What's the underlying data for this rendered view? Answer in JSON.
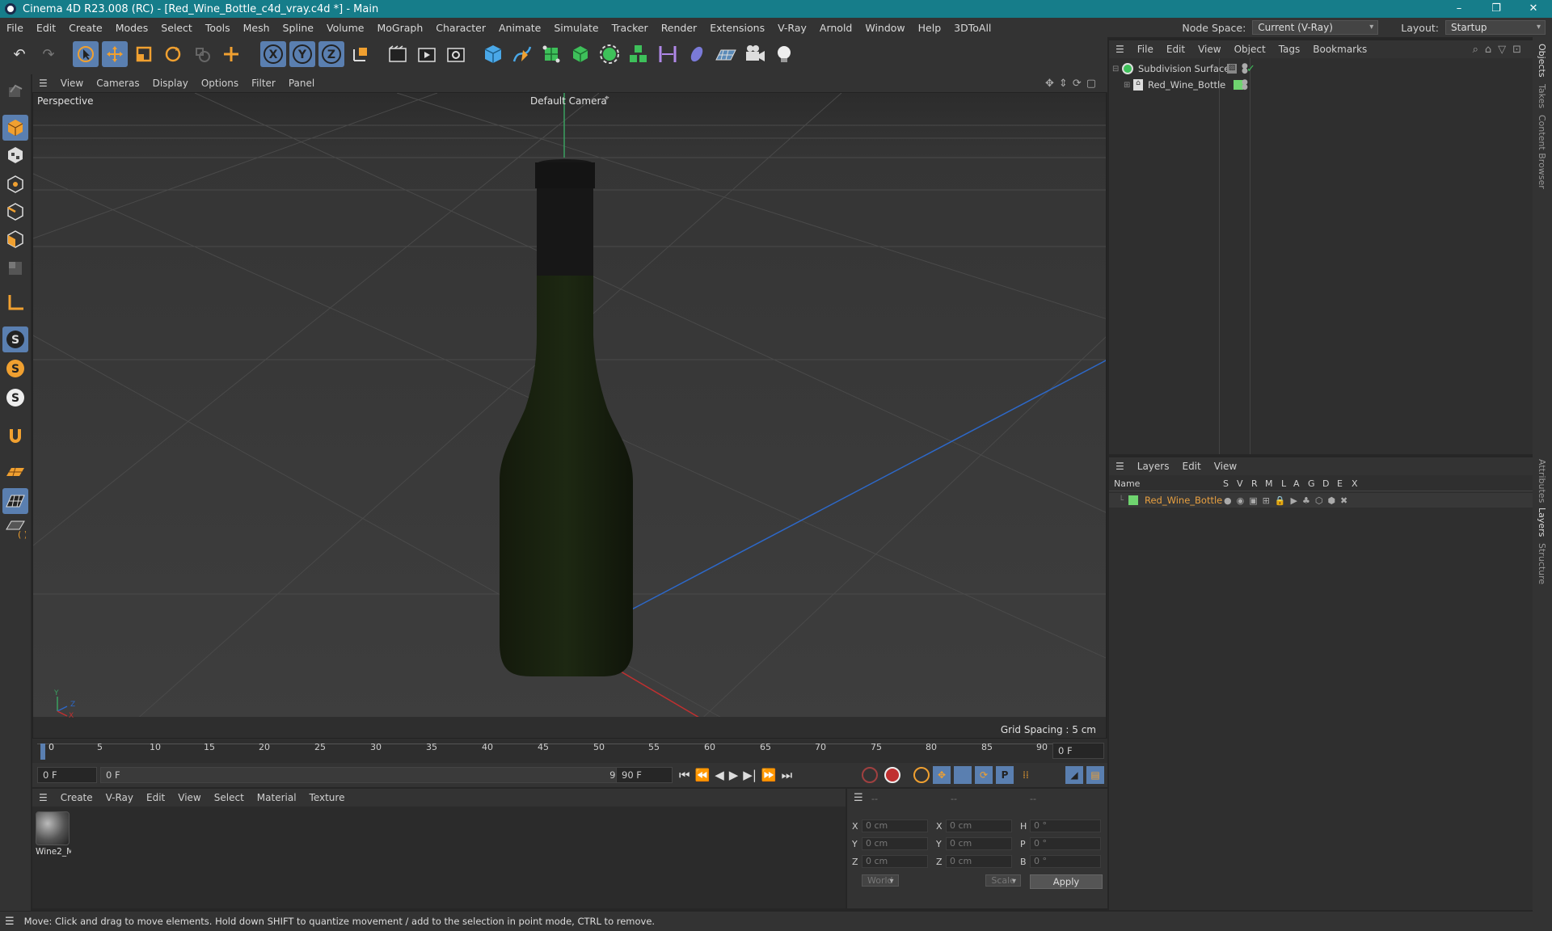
{
  "window": {
    "title": "Cinema 4D R23.008 (RC) - [Red_Wine_Bottle_c4d_vray.c4d *] - Main",
    "minimize": "–",
    "restore": "❐",
    "close": "✕"
  },
  "menubar": {
    "items": [
      "File",
      "Edit",
      "Create",
      "Modes",
      "Select",
      "Tools",
      "Mesh",
      "Spline",
      "Volume",
      "MoGraph",
      "Character",
      "Animate",
      "Simulate",
      "Tracker",
      "Render",
      "Extensions",
      "V-Ray",
      "Arnold",
      "Window",
      "Help",
      "3DToAll"
    ],
    "node_space_label": "Node Space:",
    "node_space_value": "Current (V-Ray)",
    "layout_label": "Layout:",
    "layout_value": "Startup"
  },
  "viewport": {
    "menu": [
      "View",
      "Cameras",
      "Display",
      "Options",
      "Filter",
      "Panel"
    ],
    "projection": "Perspective",
    "camera": "Default Camera",
    "grid_spacing": "Grid Spacing : 5 cm",
    "axis_y": "Y",
    "axis_z": "Z",
    "axis_x": "X"
  },
  "timeline": {
    "ticks": [
      "0",
      "5",
      "10",
      "15",
      "20",
      "25",
      "30",
      "35",
      "40",
      "45",
      "50",
      "55",
      "60",
      "65",
      "70",
      "75",
      "80",
      "85",
      "90"
    ],
    "current_frame": "0 F"
  },
  "transport": {
    "start": "0 F",
    "range_start": "0 F",
    "range_end": "90 F",
    "end": "90 F"
  },
  "materials": {
    "menu": [
      "Create",
      "V-Ray",
      "Edit",
      "View",
      "Select",
      "Material",
      "Texture"
    ],
    "items": [
      {
        "name": "Wine2_M"
      }
    ]
  },
  "coordinates": {
    "header": [
      "--",
      "--",
      "--"
    ],
    "rows": [
      {
        "l1": "X",
        "v1": "0 cm",
        "l2": "X",
        "v2": "0 cm",
        "l3": "H",
        "v3": "0 °"
      },
      {
        "l1": "Y",
        "v1": "0 cm",
        "l2": "Y",
        "v2": "0 cm",
        "l3": "P",
        "v3": "0 °"
      },
      {
        "l1": "Z",
        "v1": "0 cm",
        "l2": "Z",
        "v2": "0 cm",
        "l3": "B",
        "v3": "0 °"
      }
    ],
    "mode": "World",
    "type": "Scale",
    "apply": "Apply"
  },
  "objects": {
    "menu": [
      "File",
      "Edit",
      "View",
      "Object",
      "Tags",
      "Bookmarks"
    ],
    "items": [
      {
        "name": "Subdivision Surface",
        "color": "#cfcfcf"
      },
      {
        "name": "Red_Wine_Bottle",
        "color": "#cfcfcf"
      }
    ]
  },
  "layers": {
    "menu": [
      "Layers",
      "Edit",
      "View"
    ],
    "columns": [
      "Name",
      "S",
      "V",
      "R",
      "M",
      "L",
      "A",
      "G",
      "D",
      "E",
      "X"
    ],
    "items": [
      {
        "name": "Red_Wine_Bottle",
        "color": "#e8a040",
        "swatch": "#6fd46f"
      }
    ]
  },
  "side_tabs": [
    "Objects",
    "Takes",
    "Content Browser",
    "Attributes",
    "Layers",
    "Structure"
  ],
  "status": {
    "text": "Move: Click and drag to move elements. Hold down SHIFT to quantize movement / add to the selection in point mode, CTRL to remove."
  },
  "colors": {
    "title_bar": "#167d8a",
    "selection": "#5a7fb0",
    "bottle": "#18200f"
  }
}
